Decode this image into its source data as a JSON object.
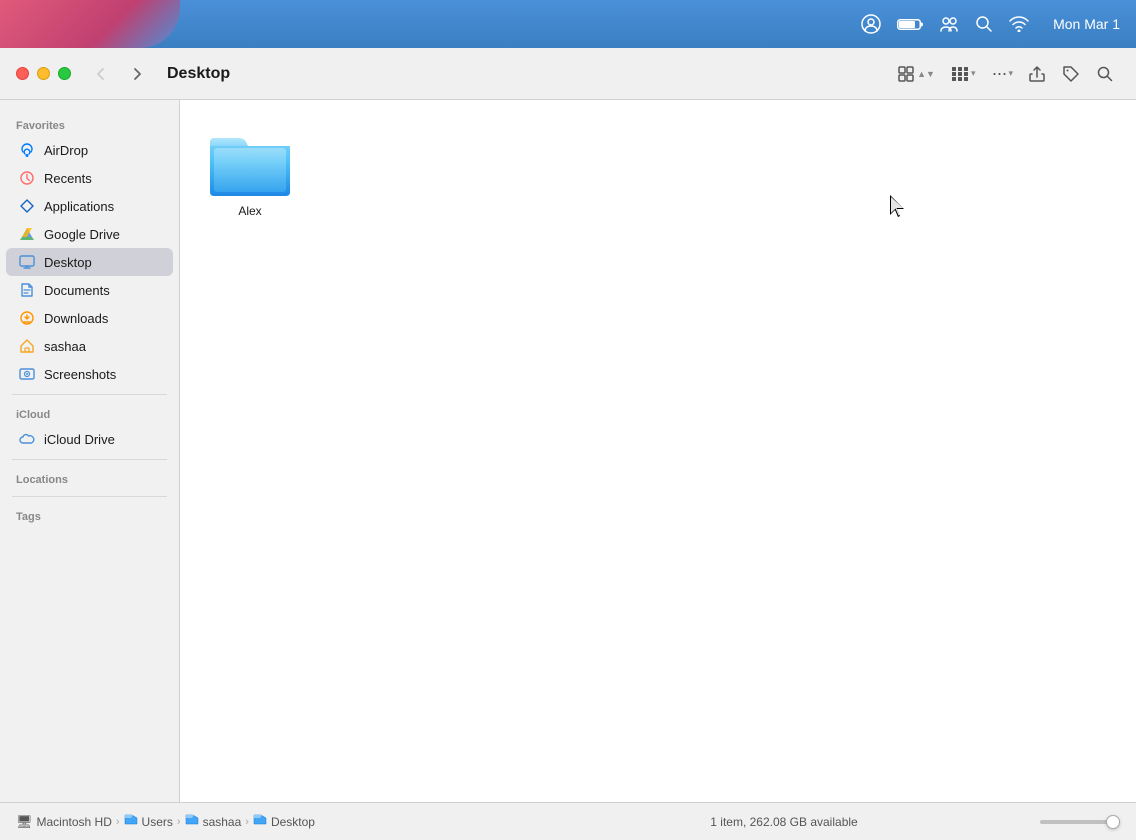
{
  "menubar": {
    "time": "Mon Mar 1",
    "icons": [
      "portrait-icon",
      "battery-icon",
      "user-switch-icon",
      "search-icon",
      "wifi-icon"
    ]
  },
  "toolbar": {
    "back_disabled": true,
    "forward_disabled": false,
    "title": "Desktop",
    "view_grid_label": "grid view",
    "view_group_label": "group view",
    "actions_label": "•••",
    "share_label": "share",
    "tag_label": "tag",
    "search_label": "search"
  },
  "sidebar": {
    "favorites_label": "Favorites",
    "icloud_label": "iCloud",
    "locations_label": "Locations",
    "tags_label": "Tags",
    "items": [
      {
        "id": "airdrop",
        "label": "AirDrop",
        "icon": "airdrop"
      },
      {
        "id": "recents",
        "label": "Recents",
        "icon": "recents"
      },
      {
        "id": "applications",
        "label": "Applications",
        "icon": "applications"
      },
      {
        "id": "googledrive",
        "label": "Google Drive",
        "icon": "googledrive"
      },
      {
        "id": "desktop",
        "label": "Desktop",
        "icon": "desktop",
        "active": true
      },
      {
        "id": "documents",
        "label": "Documents",
        "icon": "documents"
      },
      {
        "id": "downloads",
        "label": "Downloads",
        "icon": "downloads"
      },
      {
        "id": "home",
        "label": "sashaa",
        "icon": "home"
      },
      {
        "id": "screenshots",
        "label": "Screenshots",
        "icon": "screenshots"
      }
    ],
    "icloud_items": [
      {
        "id": "icloud-drive",
        "label": "iCloud Drive",
        "icon": "icloud"
      }
    ]
  },
  "files": [
    {
      "name": "Alex",
      "type": "folder"
    }
  ],
  "statusbar": {
    "breadcrumb": [
      {
        "label": "Macintosh HD",
        "icon": "hd"
      },
      {
        "label": "Users",
        "icon": "folder"
      },
      {
        "label": "sashaa",
        "icon": "folder"
      },
      {
        "label": "Desktop",
        "icon": "folder"
      }
    ],
    "info": "1 item, 262.08 GB available"
  }
}
